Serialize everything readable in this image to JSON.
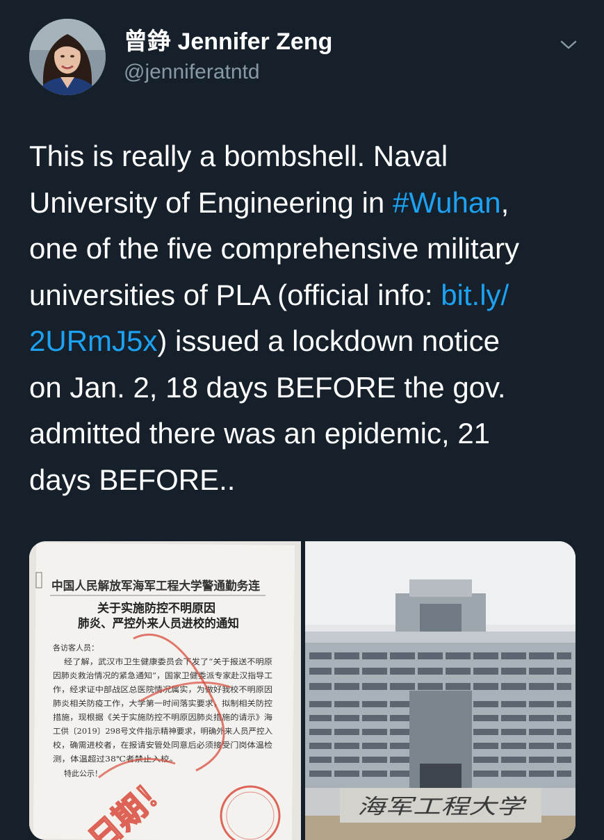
{
  "author": {
    "display_name": "曾錚 Jennifer Zeng",
    "handle": "@jenniferatntd"
  },
  "icons": {
    "more": "chevron-down-icon"
  },
  "tweet": {
    "line1": "This is really a bombshell. Naval",
    "line2_prefix": "University of Engineering in ",
    "line2_hashtag": "#Wuhan",
    "line2_suffix": ",",
    "line3": "one of the five comprehensive military",
    "line4_prefix": "universities of PLA (official info: ",
    "line4_link": "bit.ly/",
    "line5_link": "2URmJ5x",
    "line5_suffix": ") issued a lockdown notice",
    "line6": "on Jan. 2, 18 days BEFORE the gov.",
    "line7": "admitted there was an epidemic, 21",
    "line8": "days BEFORE.."
  },
  "media": {
    "notice": {
      "header": "中国人民解放军海军工程大学警通勤务连",
      "title1": "关于实施防控不明原因",
      "title2": "肺炎、严控外来人员进校的通知",
      "salutation": "各访客人员：",
      "body": [
        "经了解，武汉市卫生健康委员会下发了“关于报送不明原",
        "因肺炎救治情况的紧急通知”，国家卫健委派专家赴汉指导工",
        "作，经求证中部战区总医院情况属实，为做好我校不明原因",
        "肺炎相关防疫工作，大学第一时间落实要求，拟制相关防控",
        "措施，现根据《关于实施防控不明原因肺炎措施的请示》海",
        "工供〔2019〕298号文件指示精神要求，明确外来人员严控入",
        "校，确需进校者，在报请安管处同意后必须接受门岗体温检",
        "测，体温超过38℃者禁止入校。"
      ],
      "closing": "特此公示！",
      "stamp_text": "日期！"
    },
    "building": {
      "sign": "海军工程大学"
    }
  },
  "colors": {
    "background": "#15202b",
    "text": "#ffffff",
    "secondary": "#8899a6",
    "link": "#1da1f2"
  }
}
